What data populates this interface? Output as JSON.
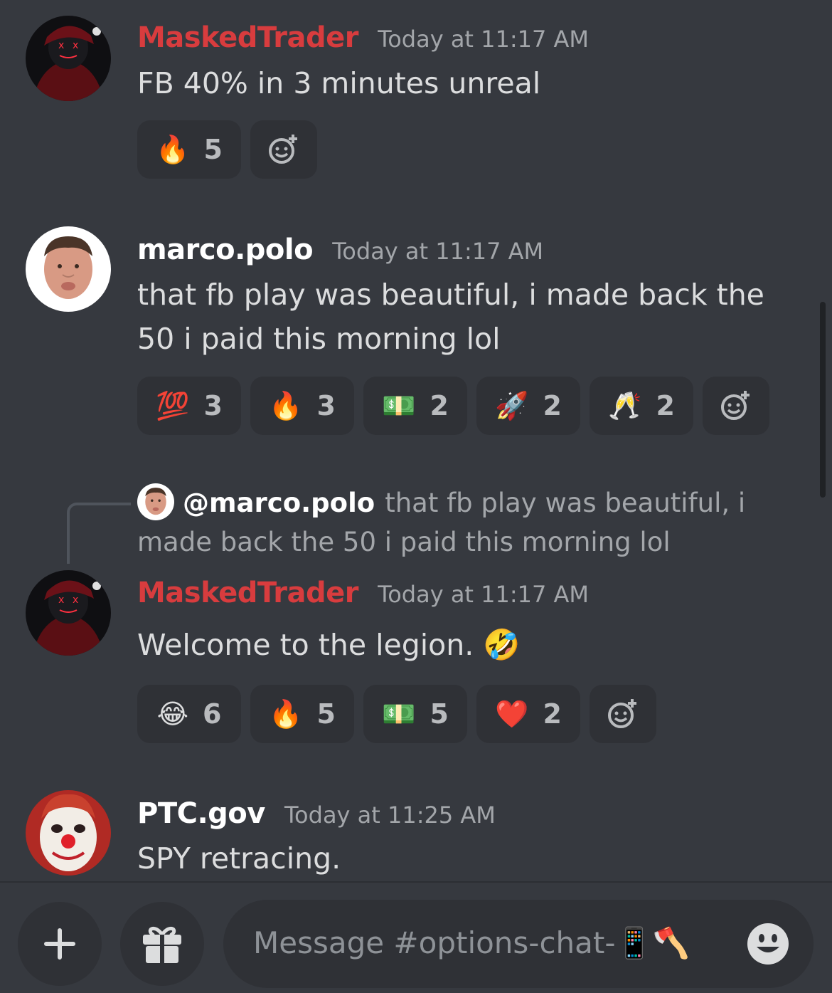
{
  "messages": [
    {
      "author": "MaskedTrader",
      "author_color": "#d83c3e",
      "timestamp": "Today at 11:17 AM",
      "text": "FB 40% in 3 minutes unreal",
      "avatar": "masked-figure-avatar",
      "reactions": [
        {
          "emoji": "🔥",
          "count": "5"
        }
      ]
    },
    {
      "author": "marco.polo",
      "author_color": "#ffffff",
      "timestamp": "Today at 11:17 AM",
      "text": "that fb play was beautiful, i made back the 50 i paid this morning lol",
      "avatar": "man-face-avatar",
      "reactions": [
        {
          "emoji": "💯",
          "count": "3"
        },
        {
          "emoji": "🔥",
          "count": "3"
        },
        {
          "emoji": "💵",
          "count": "2"
        },
        {
          "emoji": "🚀",
          "count": "2"
        },
        {
          "emoji": "🥂",
          "count": "2"
        }
      ]
    },
    {
      "reply_to": {
        "mention": "@marco.polo",
        "text": "that fb play was beautiful, i made back the 50 i paid this morning lol"
      },
      "author": "MaskedTrader",
      "author_color": "#d83c3e",
      "timestamp": "Today at 11:17 AM",
      "text": "Welcome to the legion.",
      "text_emoji": "🤣",
      "avatar": "masked-figure-avatar",
      "reactions": [
        {
          "emoji": "😂",
          "count": "6"
        },
        {
          "emoji": "🔥",
          "count": "5"
        },
        {
          "emoji": "💵",
          "count": "5"
        },
        {
          "emoji": "❤️",
          "count": "2"
        }
      ]
    },
    {
      "author": "PTC.gov",
      "author_color": "#ffffff",
      "timestamp": "Today at 11:25 AM",
      "text": "SPY retracing.",
      "avatar": "clown-face-avatar"
    }
  ],
  "composer": {
    "placeholder": "Message #options-chat-📱🪓",
    "plus_icon": "plus-icon",
    "gift_icon": "gift-icon",
    "emoji_icon": "smiley-icon"
  },
  "colors": {
    "background": "#36393f",
    "reaction_bg": "#2f3136",
    "timestamp": "#a3a6aa"
  }
}
